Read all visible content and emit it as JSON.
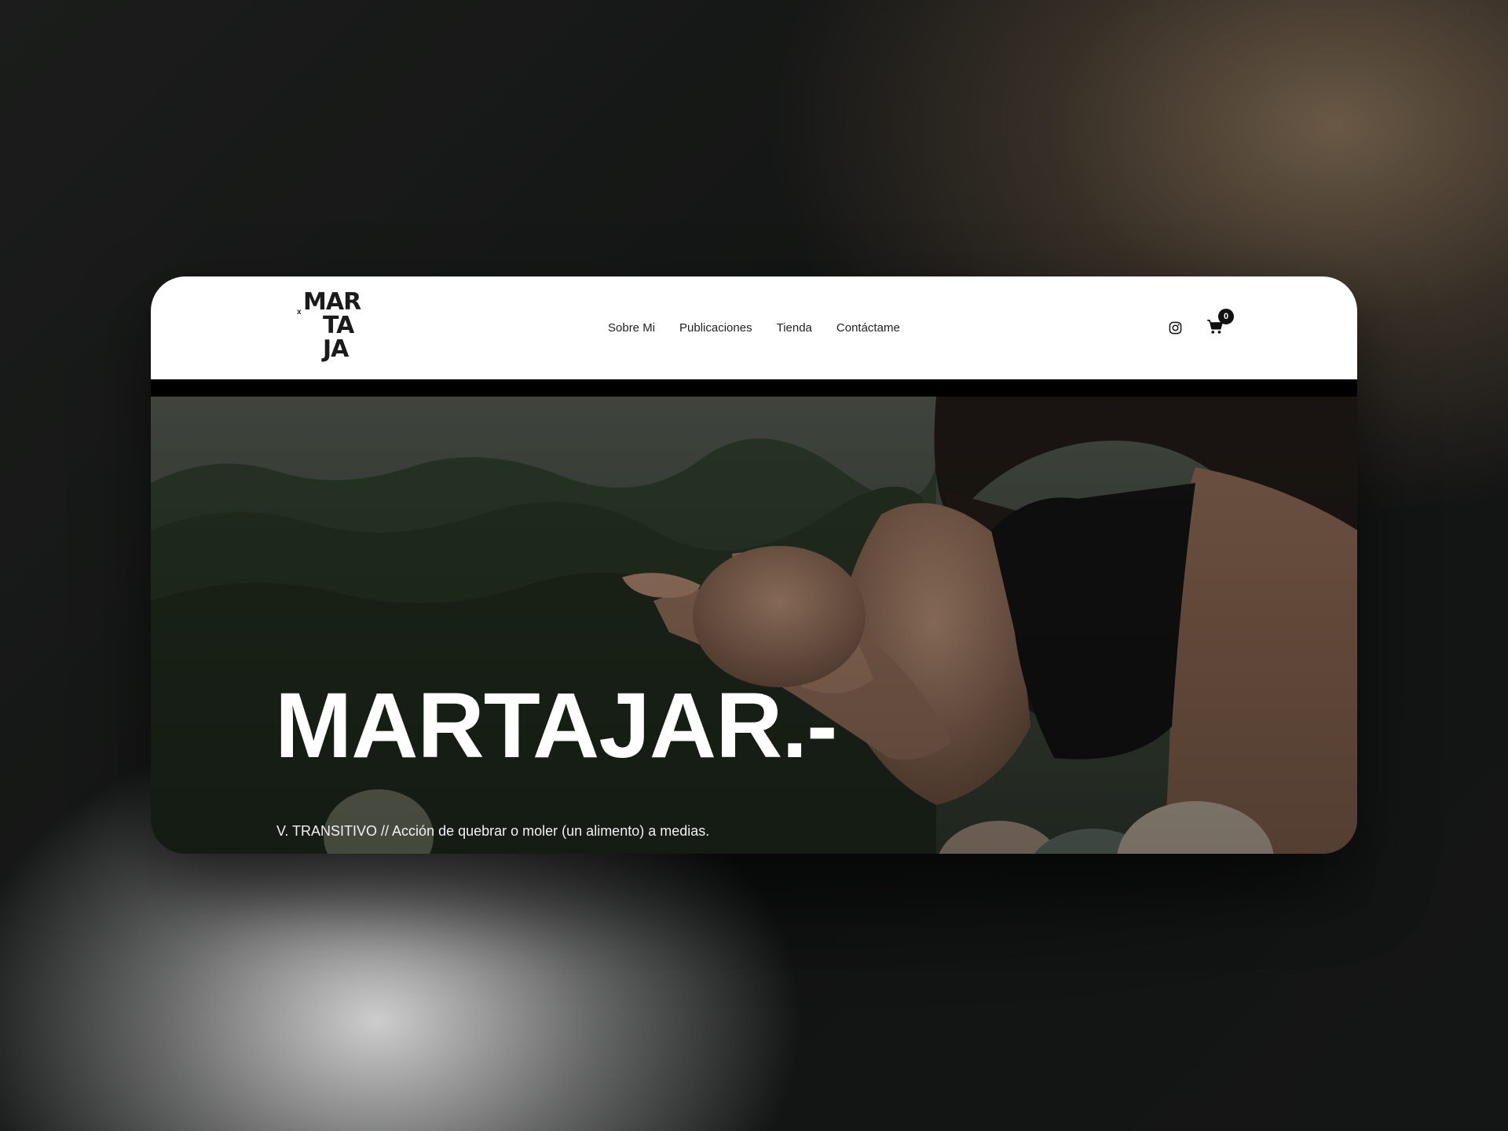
{
  "brand": {
    "logo_mark": "x",
    "logo_line1": "MAR",
    "logo_line2": "TA",
    "logo_line3": "JA"
  },
  "nav": {
    "items": [
      {
        "label": "Sobre Mi"
      },
      {
        "label": "Publicaciones"
      },
      {
        "label": "Tienda"
      },
      {
        "label": "Contáctame"
      }
    ]
  },
  "header_icons": {
    "instagram_icon": "instagram-icon",
    "cart_icon": "cart-icon",
    "cart_count": "0"
  },
  "hero": {
    "title": "MARTAJAR.-",
    "subtitle": "V. TRANSITIVO // Acción de quebrar o moler (un alimento) a medias."
  },
  "colors": {
    "header_bg": "#ffffff",
    "text_dark": "#222222",
    "hero_text": "#ffffff"
  }
}
